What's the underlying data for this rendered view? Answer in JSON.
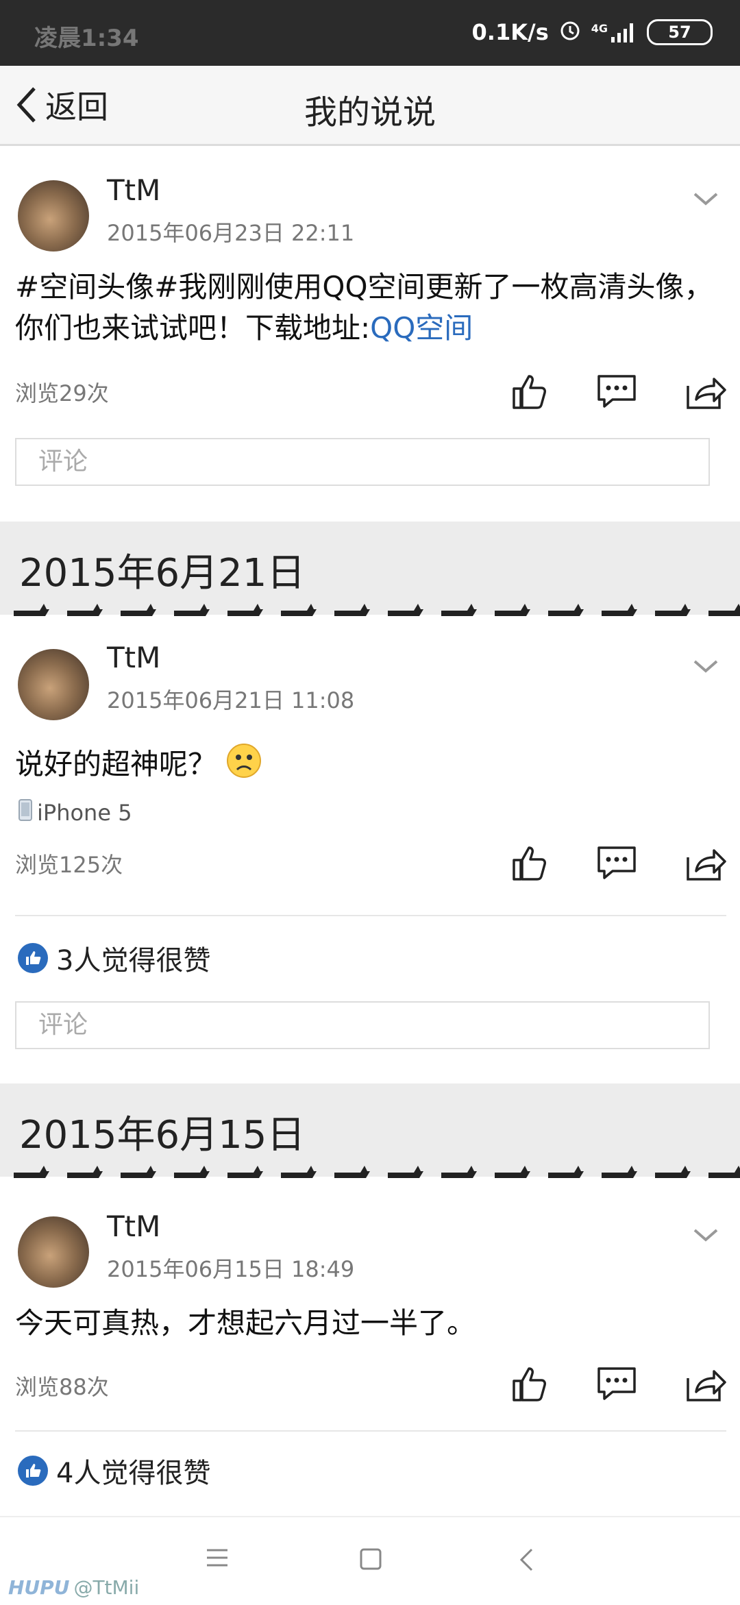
{
  "status": {
    "time": "凌晨1:34",
    "net": "0.1K/s",
    "signal": "4G",
    "battery": "57"
  },
  "nav": {
    "back_label": "返回",
    "title": "我的说说"
  },
  "posts": [
    {
      "author": "TtM",
      "time": "2015年06月23日 22:11",
      "text": "#空间头像#我刚刚使用QQ空间更新了一枚高清头像，你们也来试试吧！下载地址:",
      "link": "QQ空间",
      "views": "浏览29次",
      "comment_placeholder": "评论"
    },
    {
      "author": "TtM",
      "time": "2015年06月21日 11:08",
      "text": "说好的超神呢？",
      "device": "iPhone 5",
      "views": "浏览125次",
      "likes": "3人觉得很赞",
      "comment_placeholder": "评论"
    },
    {
      "author": "TtM",
      "time": "2015年06月15日 18:49",
      "text": "今天可真热，才想起六月过一半了。",
      "views": "浏览88次",
      "likes": "4人觉得很赞"
    }
  ],
  "date_banners": [
    "2015年6月21日",
    "2015年6月15日"
  ],
  "watermark": {
    "brand": "HUPU",
    "user": "@TtMii"
  }
}
